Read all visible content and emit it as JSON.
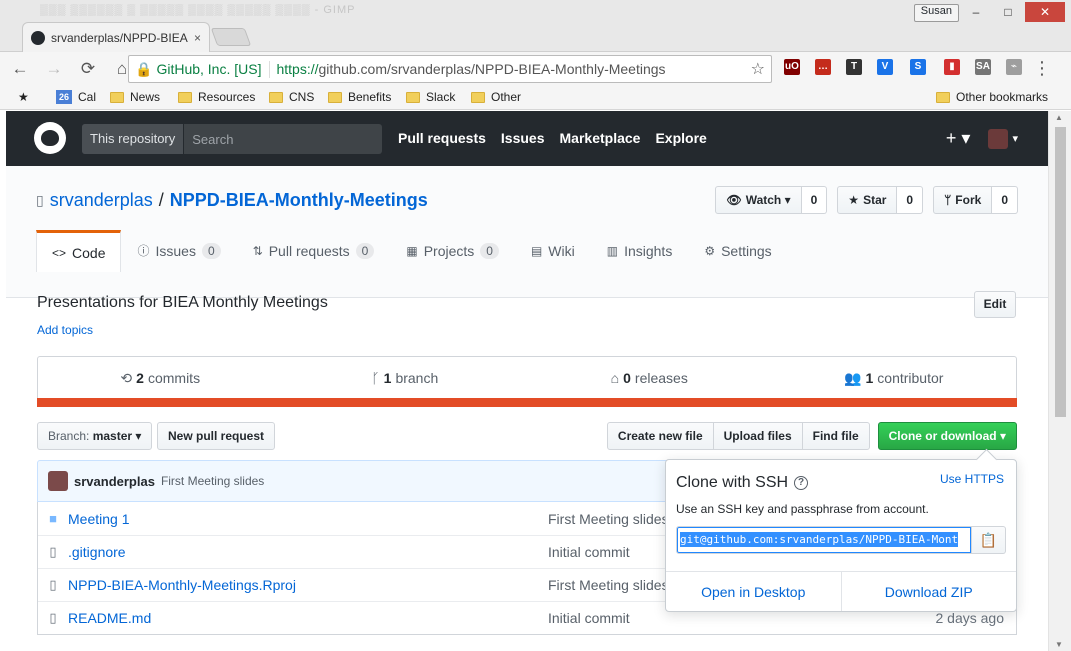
{
  "browser": {
    "tab_title": "srvanderplas/NPPD-BIEA",
    "tab_close": "×",
    "window_blur_title": "- GIMP",
    "profile_name": "Susan",
    "window_buttons": {
      "minimize": "–",
      "maximize": "□",
      "close": "✕"
    },
    "nav": {
      "back": "←",
      "forward": "→",
      "reload": "⟳",
      "home": "⌂"
    },
    "secure_label": "GitHub, Inc. [US]",
    "url_scheme": "https://",
    "url_rest": "github.com/srvanderplas/NPPD-BIEA-Monthly-Meetings",
    "bookmark_star": "☆",
    "menu": "⋮",
    "extensions": [
      {
        "label": "uO",
        "color": "#800000"
      },
      {
        "label": "…",
        "color": "#c42b1c"
      },
      {
        "label": "T",
        "color": "#333333"
      },
      {
        "label": "V",
        "color": "#1a73e8"
      },
      {
        "label": "S",
        "color": "#1a73e8"
      },
      {
        "label": "▮",
        "color": "#d32f2f"
      },
      {
        "label": "SA",
        "color": "#757575"
      },
      {
        "label": "⌁",
        "color": "#9e9e9e"
      }
    ]
  },
  "bookmarks": {
    "calendar_badge": "26",
    "items": [
      "Cal",
      "News",
      "Resources",
      "CNS",
      "Benefits",
      "Slack",
      "Other"
    ],
    "other_bookmarks": "Other bookmarks"
  },
  "github_header": {
    "search_scope": "This repository",
    "search_placeholder": "Search",
    "nav": [
      "Pull requests",
      "Issues",
      "Marketplace",
      "Explore"
    ],
    "plus": "+ ▾",
    "avatar_caret": "▾"
  },
  "repo": {
    "owner": "srvanderplas",
    "separator": "/",
    "name": "NPPD-BIEA-Monthly-Meetings",
    "watch_label": "Watch ▾",
    "watch_count": "0",
    "star_label": "Star",
    "star_count": "0",
    "fork_label": "Fork",
    "fork_count": "0",
    "tabs": [
      {
        "label": "Code",
        "icon": "<>",
        "counter": ""
      },
      {
        "label": "Issues",
        "icon": "ⓘ",
        "counter": "0"
      },
      {
        "label": "Pull requests",
        "icon": "⇅",
        "counter": "0"
      },
      {
        "label": "Projects",
        "icon": "▦",
        "counter": "0"
      },
      {
        "label": "Wiki",
        "icon": "▤",
        "counter": ""
      },
      {
        "label": "Insights",
        "icon": "▥",
        "counter": ""
      },
      {
        "label": "Settings",
        "icon": "⚙",
        "counter": ""
      }
    ],
    "description": "Presentations for BIEA Monthly Meetings",
    "add_topics": "Add topics",
    "edit_label": "Edit",
    "summary": [
      {
        "icon": "⟲",
        "count": "2",
        "label": "commits"
      },
      {
        "icon": "ᚴ",
        "count": "1",
        "label": "branch"
      },
      {
        "icon": "⌂",
        "count": "0",
        "label": "releases"
      },
      {
        "icon": "👥",
        "count": "1",
        "label": "contributor"
      }
    ],
    "branch_prefix": "Branch:",
    "branch_name": "master ▾",
    "new_pr": "New pull request",
    "file_actions": [
      "Create new file",
      "Upload files",
      "Find file"
    ],
    "clone_button": "Clone or download ▾",
    "latest_commit": {
      "author": "srvanderplas",
      "message": "First Meeting slides"
    },
    "files": [
      {
        "name": "Meeting 1",
        "type": "dir",
        "commit": "First Meeting slides",
        "age": ""
      },
      {
        "name": ".gitignore",
        "type": "file",
        "commit": "Initial commit",
        "age": ""
      },
      {
        "name": "NPPD-BIEA-Monthly-Meetings.Rproj",
        "type": "file",
        "commit": "First Meeting slides",
        "age": ""
      },
      {
        "name": "README.md",
        "type": "file",
        "commit": "Initial commit",
        "age": "2 days ago"
      }
    ]
  },
  "clone_popup": {
    "title": "Clone with SSH",
    "help": "?",
    "use_https": "Use HTTPS",
    "description": "Use an SSH key and passphrase from account.",
    "url": "git@github.com:srvanderplas/NPPD-BIEA-Mont",
    "copy_icon": "📋",
    "open_desktop": "Open in Desktop",
    "download_zip": "Download ZIP"
  }
}
